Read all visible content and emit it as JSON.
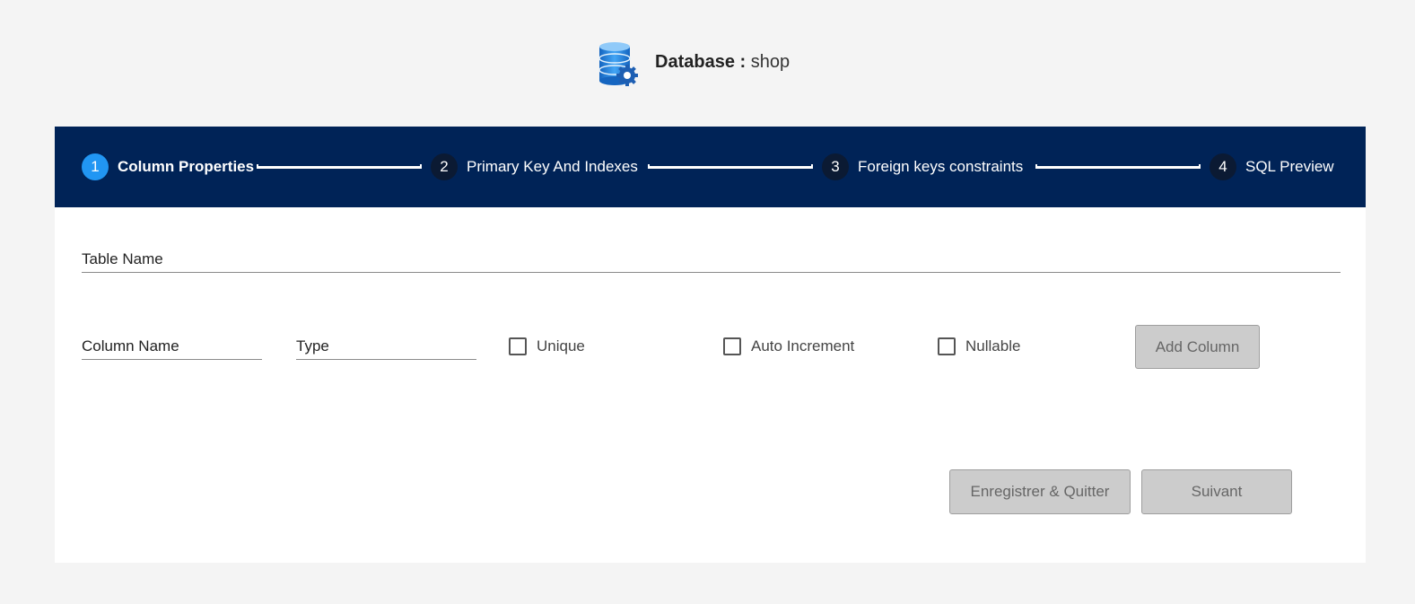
{
  "header": {
    "icon": "database-gear-icon",
    "database_label": "Database :",
    "database_name": "shop"
  },
  "stepper": {
    "steps": [
      {
        "number": "1",
        "label": "Column Properties",
        "active": true
      },
      {
        "number": "2",
        "label": "Primary Key And Indexes",
        "active": false
      },
      {
        "number": "3",
        "label": "Foreign keys constraints",
        "active": false
      },
      {
        "number": "4",
        "label": "SQL Preview",
        "active": false
      }
    ],
    "bg_color": "#002357",
    "active_color": "#2196f3"
  },
  "form": {
    "table_name_label": "Table Name",
    "column_name_label": "Column Name",
    "type_label": "Type",
    "unique_label": "Unique",
    "auto_increment_label": "Auto Increment",
    "nullable_label": "Nullable",
    "add_column_label": "Add Column"
  },
  "footer": {
    "save_quit_label": "Enregistrer & Quitter",
    "next_label": "Suivant"
  }
}
